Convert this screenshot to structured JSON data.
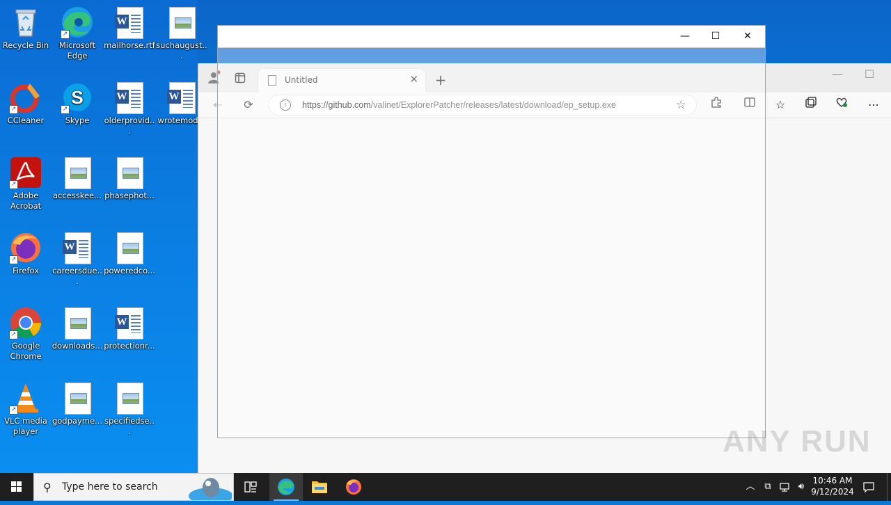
{
  "desktop": {
    "icons": [
      {
        "label": "Recycle Bin"
      },
      {
        "label": "Microsoft Edge"
      },
      {
        "label": "mailhorse.rtf"
      },
      {
        "label": "suchaugust..."
      },
      {
        "label": "CCleaner"
      },
      {
        "label": "Skype"
      },
      {
        "label": "olderprovid..."
      },
      {
        "label": "wrotemod..."
      },
      {
        "label": "Adobe Acrobat"
      },
      {
        "label": "accesskee..."
      },
      {
        "label": "phasephot..."
      },
      {
        "label": "Firefox"
      },
      {
        "label": "careersdue..."
      },
      {
        "label": "poweredco..."
      },
      {
        "label": "Google Chrome"
      },
      {
        "label": "downloads..."
      },
      {
        "label": "protectionr..."
      },
      {
        "label": "VLC media player"
      },
      {
        "label": "godpayme..."
      },
      {
        "label": "specifiedse..."
      }
    ]
  },
  "browser": {
    "tab_title": "Untitled",
    "url_domain": "https://github.com",
    "url_path": "/valinet/ExplorerPatcher/releases/latest/download/ep_setup.exe"
  },
  "watermark": "ANY RUN",
  "taskbar": {
    "search_placeholder": "Type here to search",
    "time": "10:46 AM",
    "date": "9/12/2024"
  }
}
